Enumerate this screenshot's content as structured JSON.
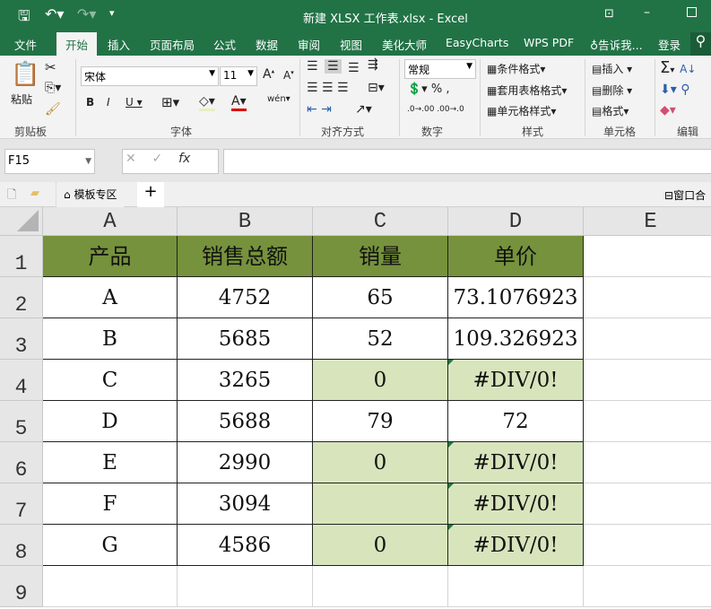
{
  "window": {
    "title": "新建 XLSX 工作表.xlsx - Excel"
  },
  "tabs": [
    "文件",
    "开始",
    "插入",
    "页面布局",
    "公式",
    "数据",
    "审阅",
    "视图",
    "美化大师",
    "EasyCharts",
    "WPS PDF",
    "告诉我...",
    "登录"
  ],
  "ribbon": {
    "paste": "粘贴",
    "font_name": "宋体",
    "font_size": "11",
    "number_format": "常规",
    "cond_format": "条件格式",
    "table_format": "套用表格格式",
    "cell_style": "单元格样式",
    "insert": "插入",
    "delete": "删除",
    "format": "格式",
    "groups": [
      "剪贴板",
      "字体",
      "对齐方式",
      "数字",
      "样式",
      "单元格",
      "编辑"
    ]
  },
  "formula_bar": {
    "name_box": "F15",
    "formula": ""
  },
  "sheet_tabs": {
    "template": "模板专区",
    "window": "窗口合"
  },
  "colors": {
    "accent": "#217346",
    "header_fill": "#76923c",
    "highlight_fill": "#d8e4bc"
  },
  "columns": [
    "A",
    "B",
    "C",
    "D",
    "E"
  ],
  "rows": [
    "1",
    "2",
    "3",
    "4",
    "5",
    "6",
    "7",
    "8",
    "9"
  ],
  "table": {
    "header": [
      "产品",
      "销售总额",
      "销量",
      "单价"
    ],
    "rows": [
      {
        "cells": [
          "A",
          "4752",
          "65",
          "73.1076923"
        ],
        "hl": false
      },
      {
        "cells": [
          "B",
          "5685",
          "52",
          "109.326923"
        ],
        "hl": false
      },
      {
        "cells": [
          "C",
          "3265",
          "0",
          "#DIV/0!"
        ],
        "hl": true
      },
      {
        "cells": [
          "D",
          "5688",
          "79",
          "72"
        ],
        "hl": false
      },
      {
        "cells": [
          "E",
          "2990",
          "0",
          "#DIV/0!"
        ],
        "hl": true
      },
      {
        "cells": [
          "F",
          "3094",
          "",
          "#DIV/0!"
        ],
        "hl": true
      },
      {
        "cells": [
          "G",
          "4586",
          "0",
          "#DIV/0!"
        ],
        "hl": true
      }
    ]
  }
}
